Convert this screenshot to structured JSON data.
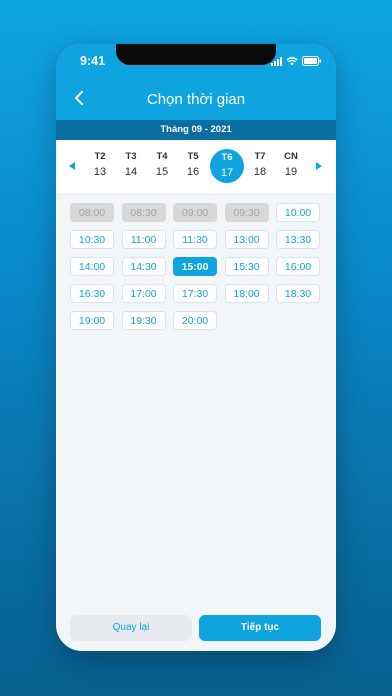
{
  "status": {
    "time": "9:41"
  },
  "header": {
    "title": "Chọn thời gian"
  },
  "month": {
    "label": "Tháng 09 - 2021"
  },
  "week": {
    "days": [
      {
        "name": "T2",
        "num": "13"
      },
      {
        "name": "T3",
        "num": "14"
      },
      {
        "name": "T4",
        "num": "15"
      },
      {
        "name": "T5",
        "num": "16"
      },
      {
        "name": "T6",
        "num": "17",
        "selected": true
      },
      {
        "name": "T7",
        "num": "18"
      },
      {
        "name": "CN",
        "num": "19"
      }
    ]
  },
  "slots": [
    {
      "time": "08:00",
      "state": "disabled"
    },
    {
      "time": "08:30",
      "state": "disabled"
    },
    {
      "time": "09:00",
      "state": "disabled"
    },
    {
      "time": "09:30",
      "state": "disabled"
    },
    {
      "time": "10:00",
      "state": "available"
    },
    {
      "time": "10:30",
      "state": "available"
    },
    {
      "time": "11:00",
      "state": "available"
    },
    {
      "time": "11:30",
      "state": "available"
    },
    {
      "time": "13:00",
      "state": "available"
    },
    {
      "time": "13:30",
      "state": "available"
    },
    {
      "time": "14:00",
      "state": "available"
    },
    {
      "time": "14:30",
      "state": "available"
    },
    {
      "time": "15:00",
      "state": "selected"
    },
    {
      "time": "15:30",
      "state": "available"
    },
    {
      "time": "16:00",
      "state": "available"
    },
    {
      "time": "16:30",
      "state": "available"
    },
    {
      "time": "17:00",
      "state": "available"
    },
    {
      "time": "17:30",
      "state": "available"
    },
    {
      "time": "18:00",
      "state": "available"
    },
    {
      "time": "18:30",
      "state": "available"
    },
    {
      "time": "19:00",
      "state": "available"
    },
    {
      "time": "19:30",
      "state": "available"
    },
    {
      "time": "20:00",
      "state": "available"
    }
  ],
  "buttons": {
    "back": "Quay lại",
    "next": "Tiếp tục"
  },
  "colors": {
    "accent": "#0fa3df",
    "month_bar": "#0a6fa0",
    "disabled": "#d8d8d8"
  }
}
